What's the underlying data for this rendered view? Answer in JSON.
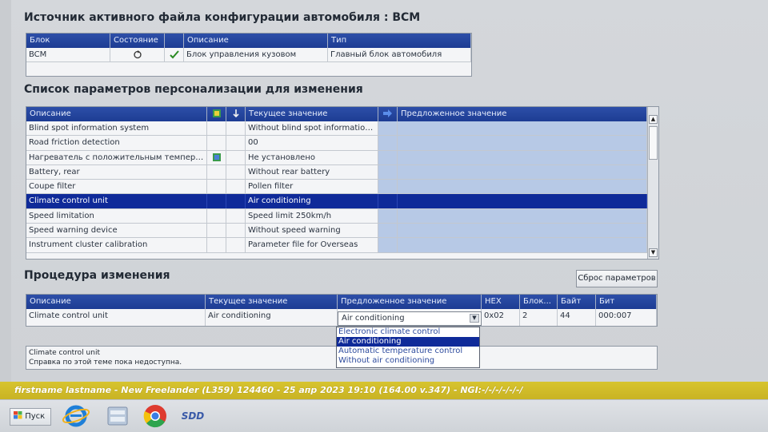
{
  "section1": {
    "title": "Источник активного файла конфигурации автомобиля : BCM",
    "columns": [
      "Блок",
      "Состояние",
      "",
      "Описание",
      "Тип"
    ],
    "row": {
      "block": "BCM",
      "description": "Блок управления кузовом",
      "type": "Главный блок автомобиля"
    }
  },
  "section2": {
    "title": "Список параметров персонализации для изменения",
    "columns": {
      "description": "Описание",
      "current": "Текущее значение",
      "proposed": "Предложенное значение"
    },
    "rows": [
      {
        "description": "Blind spot information system",
        "current": "Without blind spot information ..."
      },
      {
        "description": "Road friction detection",
        "current": "00"
      },
      {
        "description": "Нагреватель с положительным температ...",
        "current": "Не установлено"
      },
      {
        "description": "Battery, rear",
        "current": "Without rear battery"
      },
      {
        "description": "Coupe filter",
        "current": "Pollen filter"
      },
      {
        "description": "Climate control unit",
        "current": "Air conditioning"
      },
      {
        "description": "Speed limitation",
        "current": "Speed limit 250km/h"
      },
      {
        "description": "Speed warning device",
        "current": "Without speed warning"
      },
      {
        "description": "Instrument cluster calibration",
        "current": "Parameter file for Overseas"
      }
    ],
    "selected_index": 5
  },
  "section3": {
    "title": "Процедура изменения",
    "reset_label": "Сброс параметров",
    "columns": [
      "Описание",
      "Текущее значение",
      "Предложенное значение",
      "HEX",
      "Блок...",
      "Байт",
      "Бит"
    ],
    "row": {
      "description": "Climate control unit",
      "current": "Air conditioning",
      "proposed": "Air conditioning",
      "hex": "0x02",
      "block": "2",
      "byte": "44",
      "bit": "000:007"
    },
    "options": [
      "Electronic climate control",
      "Air conditioning",
      "Automatic temperature control",
      "Without air conditioning"
    ],
    "selected_option": 1,
    "help_title": "Climate control unit",
    "help_text": "Справка по этой теме пока недоступна."
  },
  "status_bar": {
    "text": "firstname lastname - New Freelander (L359) 124460 - 25 апр 2023 19:10 (164.00 v.347) - NGI:-/-/-/-/-/-/"
  },
  "taskbar": {
    "start_label": "Пуск",
    "sdd_label": "SDD"
  },
  "colors": {
    "header_blue": "#1d3c93",
    "selection": "#0f2a99",
    "status_yellow": "#d7c42f"
  },
  "icons": [
    "refresh-icon",
    "checkmark-icon",
    "flag-icon",
    "sort-icon",
    "arrow-right-icon",
    "windows-flag-icon",
    "ie-icon",
    "chrome-icon"
  ]
}
